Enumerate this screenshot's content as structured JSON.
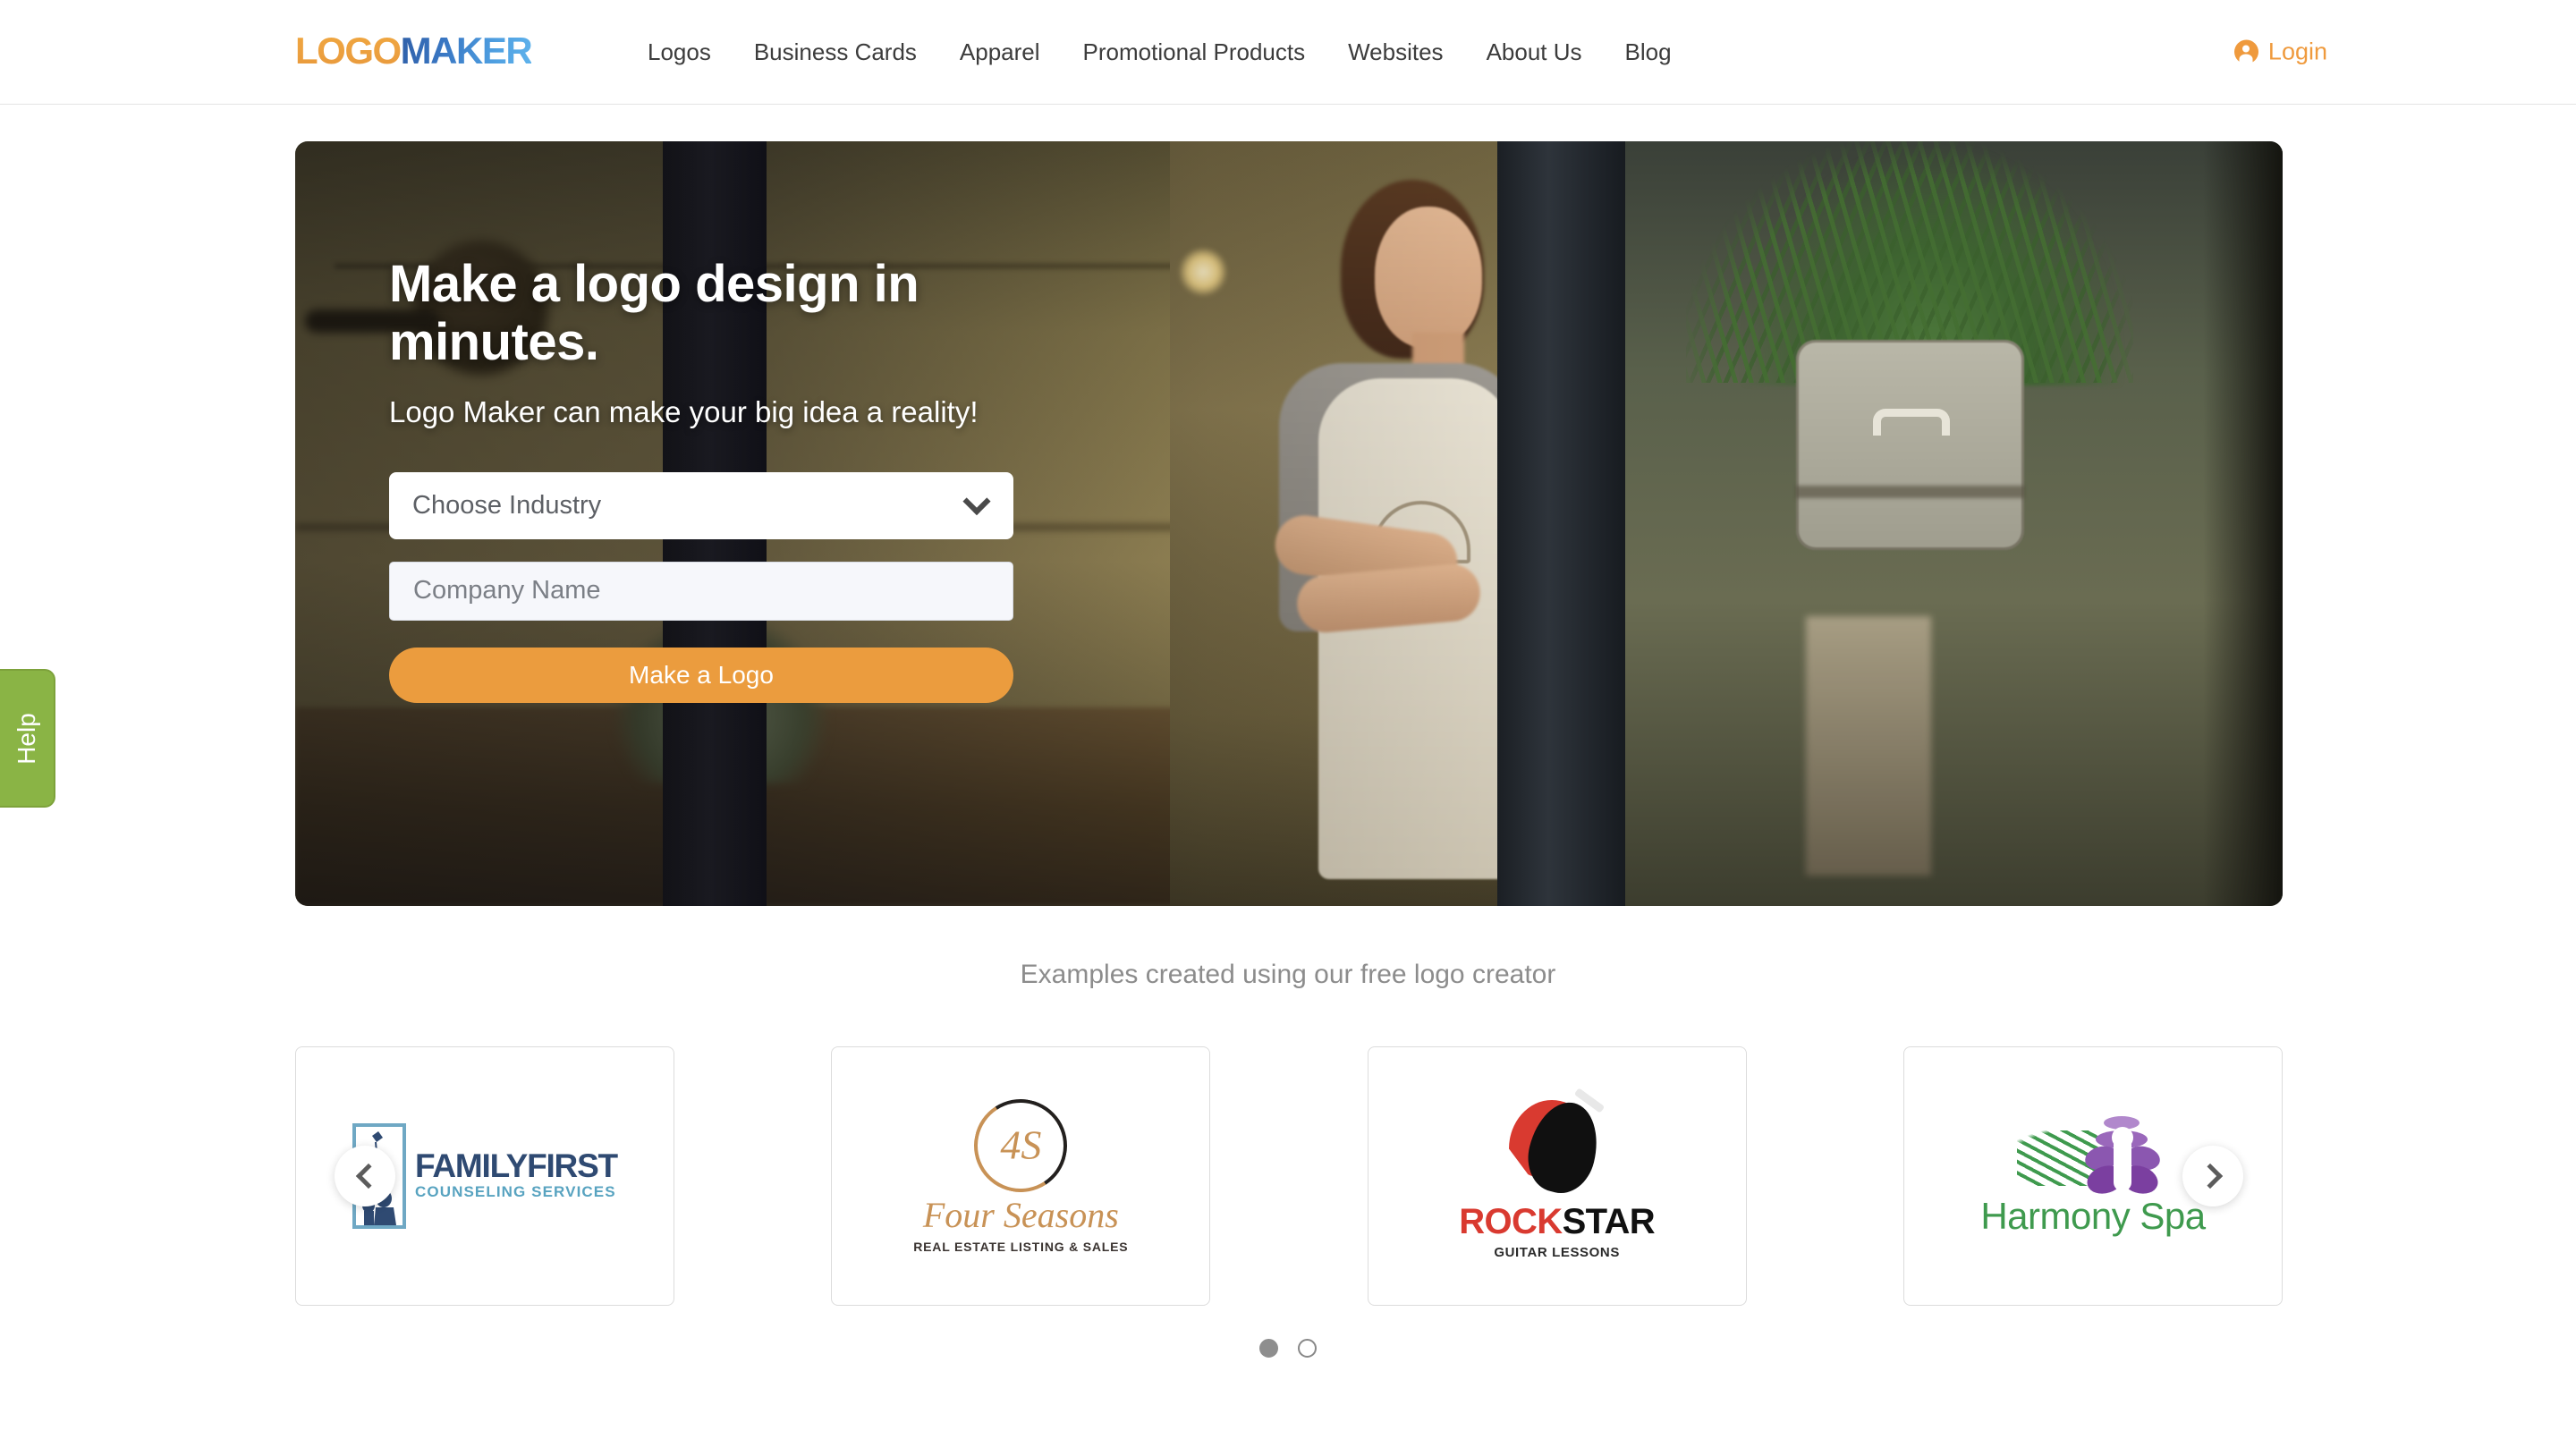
{
  "header": {
    "brand": {
      "logo_text": "LOGO",
      "maker_text": "MAKER"
    },
    "nav": [
      {
        "label": "Logos"
      },
      {
        "label": "Business Cards"
      },
      {
        "label": "Apparel"
      },
      {
        "label": "Promotional Products"
      },
      {
        "label": "Websites"
      },
      {
        "label": "About Us"
      },
      {
        "label": "Blog"
      }
    ],
    "login": {
      "label": "Login",
      "icon": "user-circle-icon",
      "color": "#ef9a3d"
    }
  },
  "help_tab": {
    "label": "Help",
    "color": "#8ab445"
  },
  "hero": {
    "title": "Make a logo design in minutes.",
    "subtitle": "Logo Maker can make your big idea a reality!",
    "industry_select": {
      "value": "Choose Industry",
      "icon": "chevron-down-icon"
    },
    "company_input": {
      "value": "",
      "placeholder": "Company Name"
    },
    "cta": {
      "label": "Make a Logo",
      "color": "#eb9c3e"
    }
  },
  "examples": {
    "caption": "Examples created using our free logo creator",
    "prev_icon": "chevron-left-icon",
    "next_icon": "chevron-right-icon",
    "cards": [
      {
        "name": "FAMILYFIRST",
        "tagline": "COUNSELING SERVICES",
        "colors": {
          "primary": "#2f4a72",
          "secondary": "#58a3c0"
        }
      },
      {
        "monogram": "4S",
        "name": "Four Seasons",
        "tagline": "REAL ESTATE LISTING & SALES",
        "colors": {
          "primary": "#c89256",
          "secondary": "#23201e"
        }
      },
      {
        "name_part1": "ROCK",
        "name_part2": "STAR",
        "tagline": "GUITAR LESSONS",
        "colors": {
          "primary": "#d93a30",
          "secondary": "#111111"
        }
      },
      {
        "name": "Harmony Spa",
        "tagline": "",
        "colors": {
          "primary": "#3f9a4e",
          "secondary": "#8b57b0"
        }
      }
    ],
    "dots": [
      {
        "active": true
      },
      {
        "active": false
      }
    ]
  }
}
